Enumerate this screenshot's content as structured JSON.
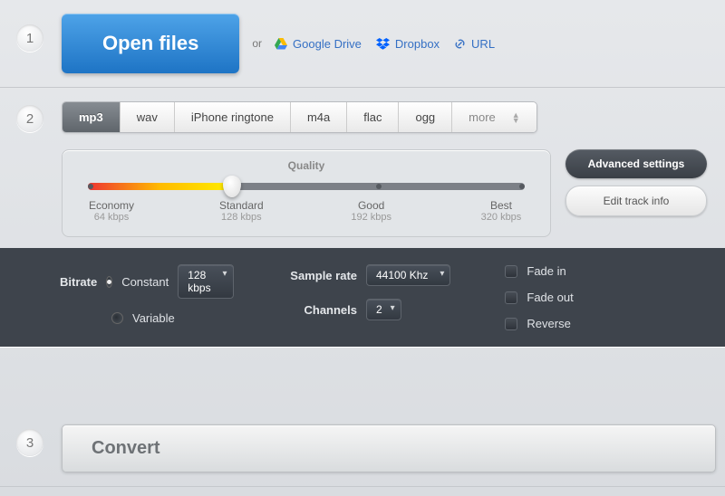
{
  "step1": {
    "num": "1",
    "open_label": "Open files",
    "or_text": "or",
    "gdrive": "Google Drive",
    "dropbox": "Dropbox",
    "url": "URL"
  },
  "step2": {
    "num": "2",
    "tabs": [
      "mp3",
      "wav",
      "iPhone ringtone",
      "m4a",
      "flac",
      "ogg",
      "more"
    ],
    "quality": {
      "title": "Quality",
      "labels": [
        {
          "name": "Economy",
          "rate": "64 kbps"
        },
        {
          "name": "Standard",
          "rate": "128 kbps"
        },
        {
          "name": "Good",
          "rate": "192 kbps"
        },
        {
          "name": "Best",
          "rate": "320 kbps"
        }
      ]
    },
    "adv_btn": "Advanced settings",
    "edit_btn": "Edit track info"
  },
  "advanced": {
    "bitrate_label": "Bitrate",
    "constant": "Constant",
    "variable": "Variable",
    "bitrate_value": "128 kbps",
    "sample_label": "Sample rate",
    "sample_value": "44100 Khz",
    "channels_label": "Channels",
    "channels_value": "2",
    "fade_in": "Fade in",
    "fade_out": "Fade out",
    "reverse": "Reverse"
  },
  "step3": {
    "num": "3",
    "convert": "Convert"
  }
}
